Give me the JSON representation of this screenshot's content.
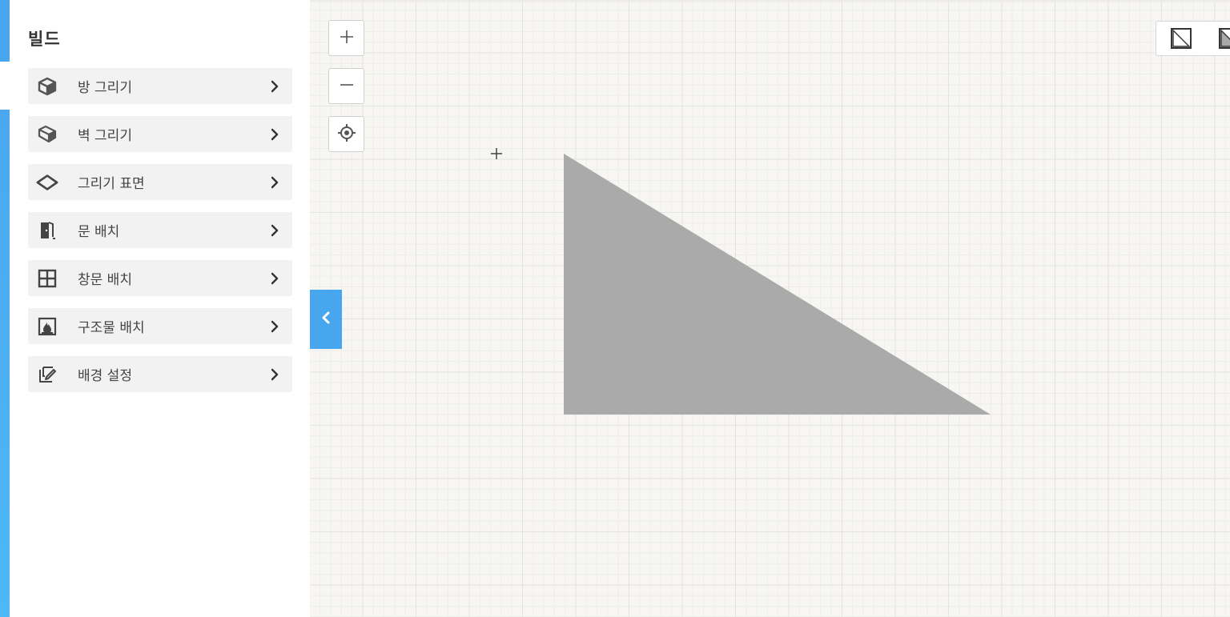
{
  "sidebar": {
    "title": "빌드",
    "items": [
      {
        "label": "방 그리기",
        "icon": "cube-icon"
      },
      {
        "label": "벽 그리기",
        "icon": "wall-block-icon"
      },
      {
        "label": "그리기 표면",
        "icon": "surface-diamond-icon"
      },
      {
        "label": "문 배치",
        "icon": "door-icon"
      },
      {
        "label": "창문 배치",
        "icon": "window-icon"
      },
      {
        "label": "구조물 배치",
        "icon": "fireplace-icon"
      },
      {
        "label": "배경 설정",
        "icon": "background-edit-icon"
      }
    ]
  },
  "canvas": {
    "controls": [
      "zoom-in-icon",
      "zoom-out-icon",
      "locate-icon"
    ],
    "shape_fill": "#aaaaaa"
  },
  "colors": {
    "accent": "#47a6ee",
    "menu_bg": "#f2f2f2",
    "grid_bg": "#f7f6f3"
  }
}
